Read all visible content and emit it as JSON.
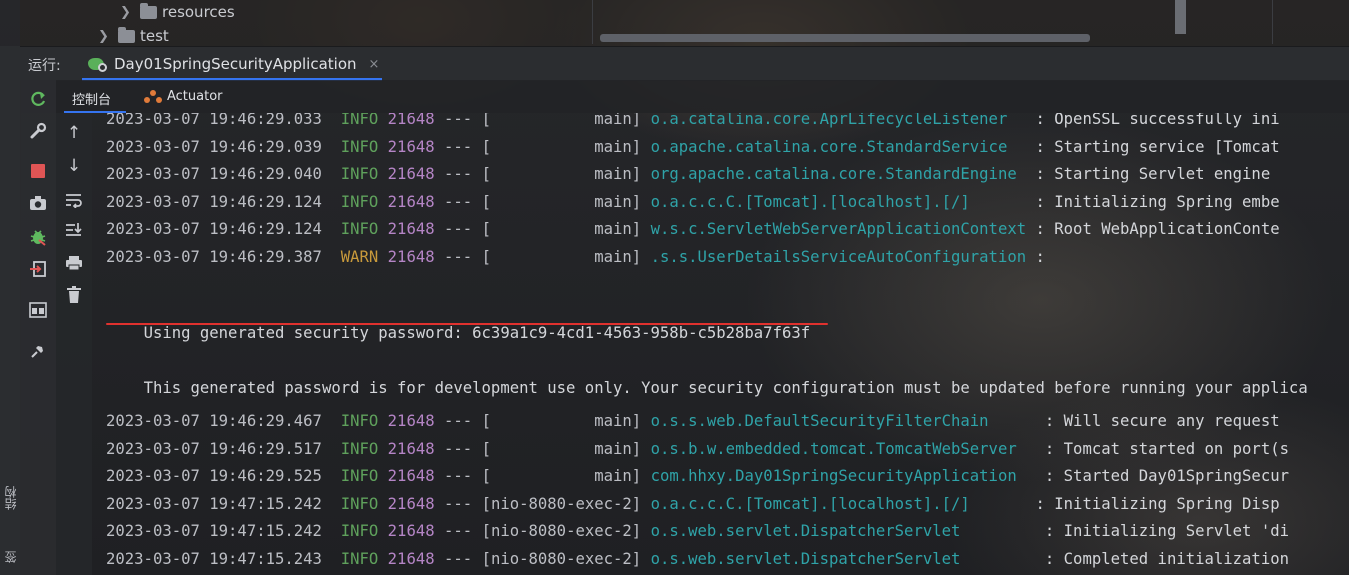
{
  "project_tree": {
    "items": [
      {
        "label": "resources"
      },
      {
        "label": "test"
      }
    ]
  },
  "run_window": {
    "label": "运行:",
    "tab_title": "Day01SpringSecurityApplication",
    "tab_close": "×"
  },
  "sub_tabs": {
    "console": "控制台",
    "actuator": "Actuator"
  },
  "side_strip": {
    "structure": "结构",
    "other": "签"
  },
  "colors": {
    "info": "#5fa15c",
    "warn": "#c99a3b",
    "pid": "#b585c6",
    "logger": "#2fa3a8",
    "highlight_underline": "#e0312e",
    "tab_accent": "#3574f0"
  },
  "toolbar_left": [
    "rerun-icon",
    "wrench-icon",
    "stop-icon",
    "camera-icon",
    "debug-bug-icon",
    "exit-icon",
    "layout-icon",
    "pin-icon"
  ],
  "toolbar_right": [
    "arrow-up-icon",
    "arrow-down-icon",
    "soft-wrap-icon",
    "scroll-to-end-icon",
    "print-icon",
    "trash-icon"
  ],
  "console": {
    "log_lines_top": [
      {
        "ts": "2023-03-07 19:46:29.033",
        "level": "INFO",
        "pid": "21648",
        "sep": "---",
        "thread": "[           main]",
        "logger": "o.a.catalina.core.AprLifecycleListener  ",
        "msg": ": OpenSSL successfully ini"
      },
      {
        "ts": "2023-03-07 19:46:29.039",
        "level": "INFO",
        "pid": "21648",
        "sep": "---",
        "thread": "[           main]",
        "logger": "o.apache.catalina.core.StandardService  ",
        "msg": ": Starting service [Tomcat"
      },
      {
        "ts": "2023-03-07 19:46:29.040",
        "level": "INFO",
        "pid": "21648",
        "sep": "---",
        "thread": "[           main]",
        "logger": "org.apache.catalina.core.StandardEngine ",
        "msg": ": Starting Servlet engine"
      },
      {
        "ts": "2023-03-07 19:46:29.124",
        "level": "INFO",
        "pid": "21648",
        "sep": "---",
        "thread": "[           main]",
        "logger": "o.a.c.c.C.[Tomcat].[localhost].[/]      ",
        "msg": ": Initializing Spring embe"
      },
      {
        "ts": "2023-03-07 19:46:29.124",
        "level": "INFO",
        "pid": "21648",
        "sep": "---",
        "thread": "[           main]",
        "logger": "w.s.c.ServletWebServerApplicationContext",
        "msg": ": Root WebApplicationConte"
      },
      {
        "ts": "2023-03-07 19:46:29.387",
        "level": "WARN",
        "pid": "21648",
        "sep": "---",
        "thread": "[           main]",
        "logger": ".s.s.UserDetailsServiceAutoConfiguration",
        "msg": ":"
      }
    ],
    "password_line": "Using generated security password: 6c39a1c9-4cd1-4563-958b-c5b28ba7f63f",
    "dev_note_line": "This generated password is for development use only. Your security configuration must be updated before running your applica",
    "log_lines_bottom": [
      {
        "ts": "2023-03-07 19:46:29.467",
        "level": "INFO",
        "pid": "21648",
        "sep": "---",
        "thread": "[           main]",
        "logger": "o.s.s.web.DefaultSecurityFilterChain     ",
        "msg": ": Will secure any request"
      },
      {
        "ts": "2023-03-07 19:46:29.517",
        "level": "INFO",
        "pid": "21648",
        "sep": "---",
        "thread": "[           main]",
        "logger": "o.s.b.w.embedded.tomcat.TomcatWebServer  ",
        "msg": ": Tomcat started on port(s"
      },
      {
        "ts": "2023-03-07 19:46:29.525",
        "level": "INFO",
        "pid": "21648",
        "sep": "---",
        "thread": "[           main]",
        "logger": "com.hhxy.Day01SpringSecurityApplication  ",
        "msg": ": Started Day01SpringSecur"
      },
      {
        "ts": "2023-03-07 19:47:15.242",
        "level": "INFO",
        "pid": "21648",
        "sep": "---",
        "thread": "[nio-8080-exec-2]",
        "logger": "o.a.c.c.C.[Tomcat].[localhost].[/]      ",
        "msg": ": Initializing Spring Disp"
      },
      {
        "ts": "2023-03-07 19:47:15.242",
        "level": "INFO",
        "pid": "21648",
        "sep": "---",
        "thread": "[nio-8080-exec-2]",
        "logger": "o.s.web.servlet.DispatcherServlet        ",
        "msg": ": Initializing Servlet 'di"
      },
      {
        "ts": "2023-03-07 19:47:15.243",
        "level": "INFO",
        "pid": "21648",
        "sep": "---",
        "thread": "[nio-8080-exec-2]",
        "logger": "o.s.web.servlet.DispatcherServlet        ",
        "msg": ": Completed initialization"
      }
    ]
  }
}
